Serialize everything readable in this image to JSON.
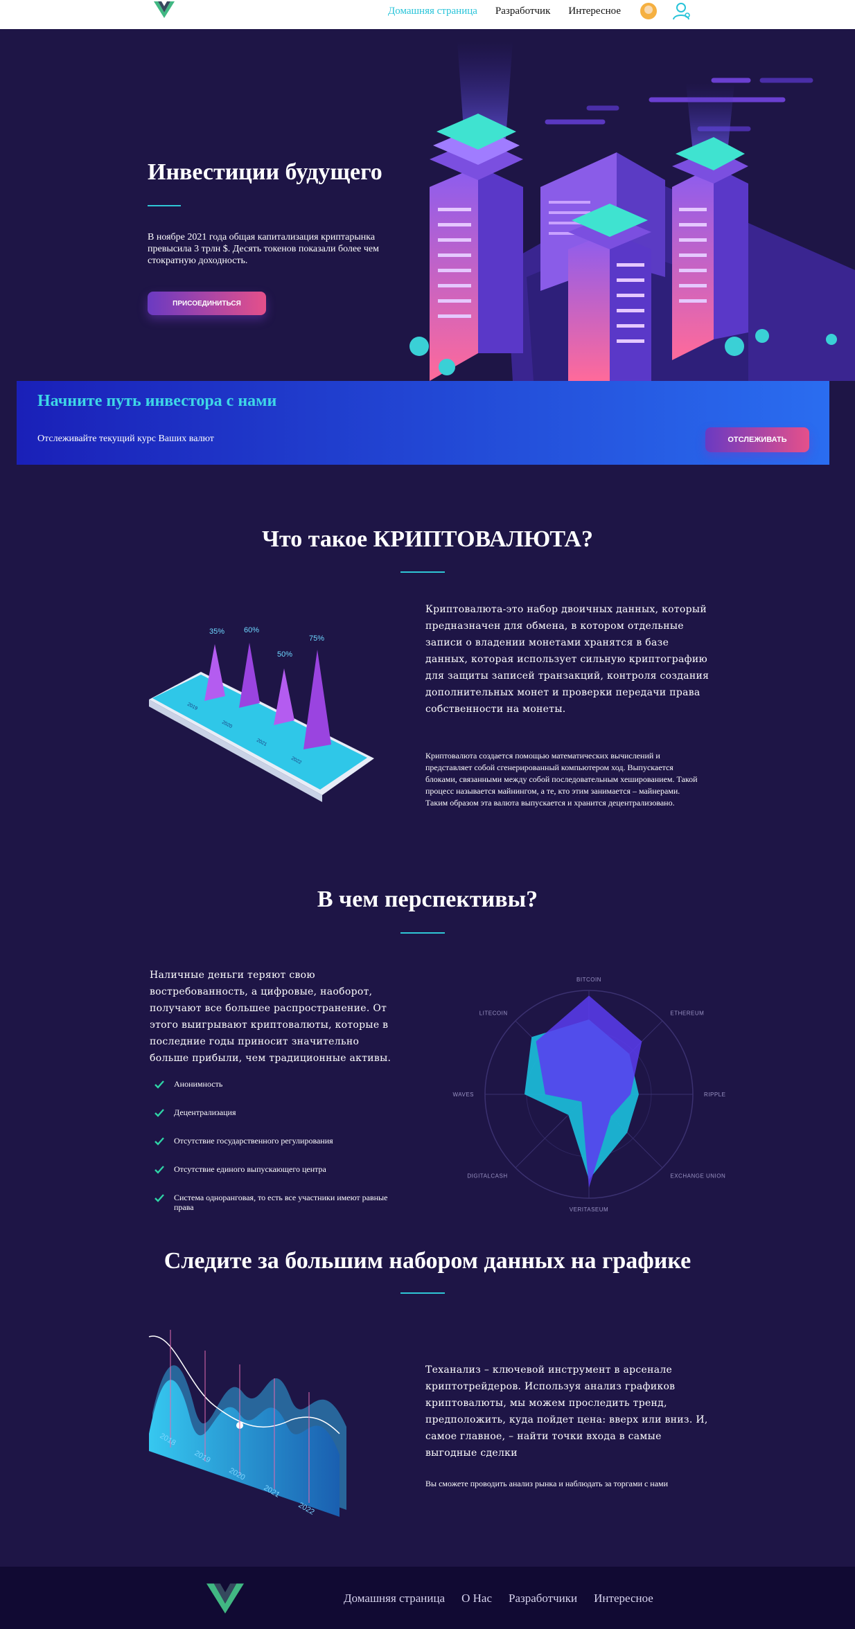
{
  "header": {
    "nav": [
      "Домашняя страница",
      "Разработчик",
      "Интересное"
    ]
  },
  "hero": {
    "title": "Инвестиции будущего",
    "text": "В ноябре 2021 года общая капитализация криптарынка превысила 3 трлн $. Десять токенов показали более чем стократную доходность.",
    "button": "ПРИСОЕДИНИТЬСЯ"
  },
  "banner": {
    "title": "Начните путь инвестора с нами",
    "text": "Отслеживайте текущий курс Ваших валют",
    "button": "ОТСЛЕЖИВАТЬ"
  },
  "what": {
    "title": "Что такое КРИПТОВАЛЮТА?",
    "paragraph1": "Криптовалюта-это набор двоичных данных, который предназначен для обмена, в котором отдельные записи о владении монетами хранятся в базе данных, которая использует сильную криптографию для защиты записей транзакций, контроля создания дополнительных монет и проверки передачи права собственности на монеты.",
    "paragraph2": "Криптовалюта создается помощью математических вычислений и представляет собой сгенерированный компьютером ход. Выпускается блоками, связанными между собой последовательным хешированием. Такой процесс называется майнингом, а те, кто этим занимается – майнерами. Таким образом эта валюта выпускается и хранится децентрализовано.",
    "illustration": {
      "percents": [
        "35%",
        "60%",
        "50%",
        "75%"
      ],
      "years": [
        "2019",
        "2020",
        "2021",
        "2022"
      ]
    }
  },
  "prospects": {
    "title": "В чем перспективы?",
    "paragraph": "Наличные деньги теряют свою востребованность, а цифровые, наоборот, получают все большее распространение. От этого выигрывают криптовалюты, которые в последние годы приносит значительно больше прибыли, чем традиционные активы.",
    "list": [
      "Анонимность",
      "Децентрализация",
      "Отсутствие государственного регулирования",
      "Отсутствие единого выпускающего центра",
      "Система одноранговая, то есть все участники имеют равные права"
    ]
  },
  "chart_data": {
    "type": "radar",
    "axes": [
      "BITCOIN",
      "ETHEREUM",
      "RIPPLE",
      "EXCHANGE UNION",
      "VERITASEUM",
      "DIGITALCASH",
      "WAVES",
      "LITECOIN"
    ],
    "ylim": [
      0,
      1
    ],
    "series": [
      {
        "values": [
          0.72,
          0.55,
          0.48,
          0.52,
          0.82,
          0.28,
          0.62,
          0.78
        ]
      },
      {
        "values": [
          0.95,
          0.72,
          0.4,
          0.3,
          0.9,
          0.1,
          0.42,
          0.72
        ]
      }
    ],
    "colors": [
      "#1bb7d6",
      "#5a3cf0"
    ]
  },
  "data_section": {
    "title": "Следите за большим набором данных на графике",
    "paragraph": "Теханализ – ключевой инструмент в арсенале криптотрейдеров. Используя анализ графиков криптовалюты, мы можем проследить тренд, предположить, куда пойдет цена: вверх или вниз. И, самое главное, – найти точки входа в самые выгодные сделки",
    "small": "Вы сможете проводить анализ рынка и наблюдать за торгами с нами",
    "illustration_years": [
      "2018",
      "2019",
      "2020",
      "2021",
      "2022"
    ]
  },
  "footer": {
    "nav": [
      "Домашняя страница",
      "О Нас",
      "Разработчики",
      "Интересное"
    ]
  },
  "colors": {
    "background": "#1e1546",
    "accent": "#2fc7d6",
    "button_from": "#6a3ac2",
    "button_to": "#e5508a",
    "banner": "#1a20b8",
    "footer": "#110a33"
  }
}
